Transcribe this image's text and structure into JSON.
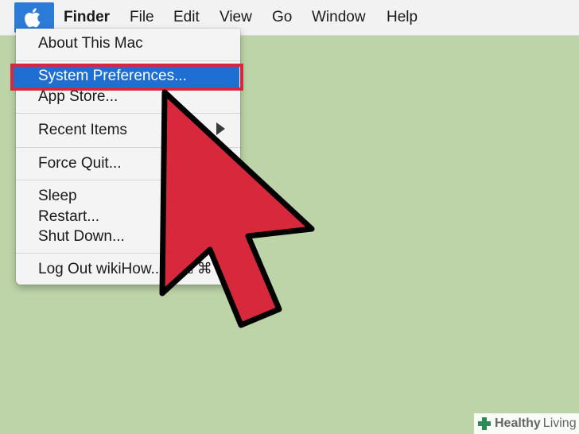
{
  "menubar": {
    "app_name": "Finder",
    "items": [
      "File",
      "Edit",
      "View",
      "Go",
      "Window",
      "Help"
    ]
  },
  "apple_menu": {
    "about": "About This Mac",
    "system_preferences": "System Preferences...",
    "app_store": "App Store...",
    "recent_items": "Recent Items",
    "force_quit": "Force Quit...",
    "sleep": "Sleep",
    "restart": "Restart...",
    "shut_down": "Shut Down...",
    "log_out": "Log Out wikiHow...",
    "log_out_shortcut": "⇧⌘"
  },
  "watermark": {
    "word1": "Healthy",
    "word2": "Living"
  },
  "colors": {
    "desktop": "#bdd4a8",
    "highlight": "#1f6fd2",
    "annotation_red": "#d7263d"
  }
}
